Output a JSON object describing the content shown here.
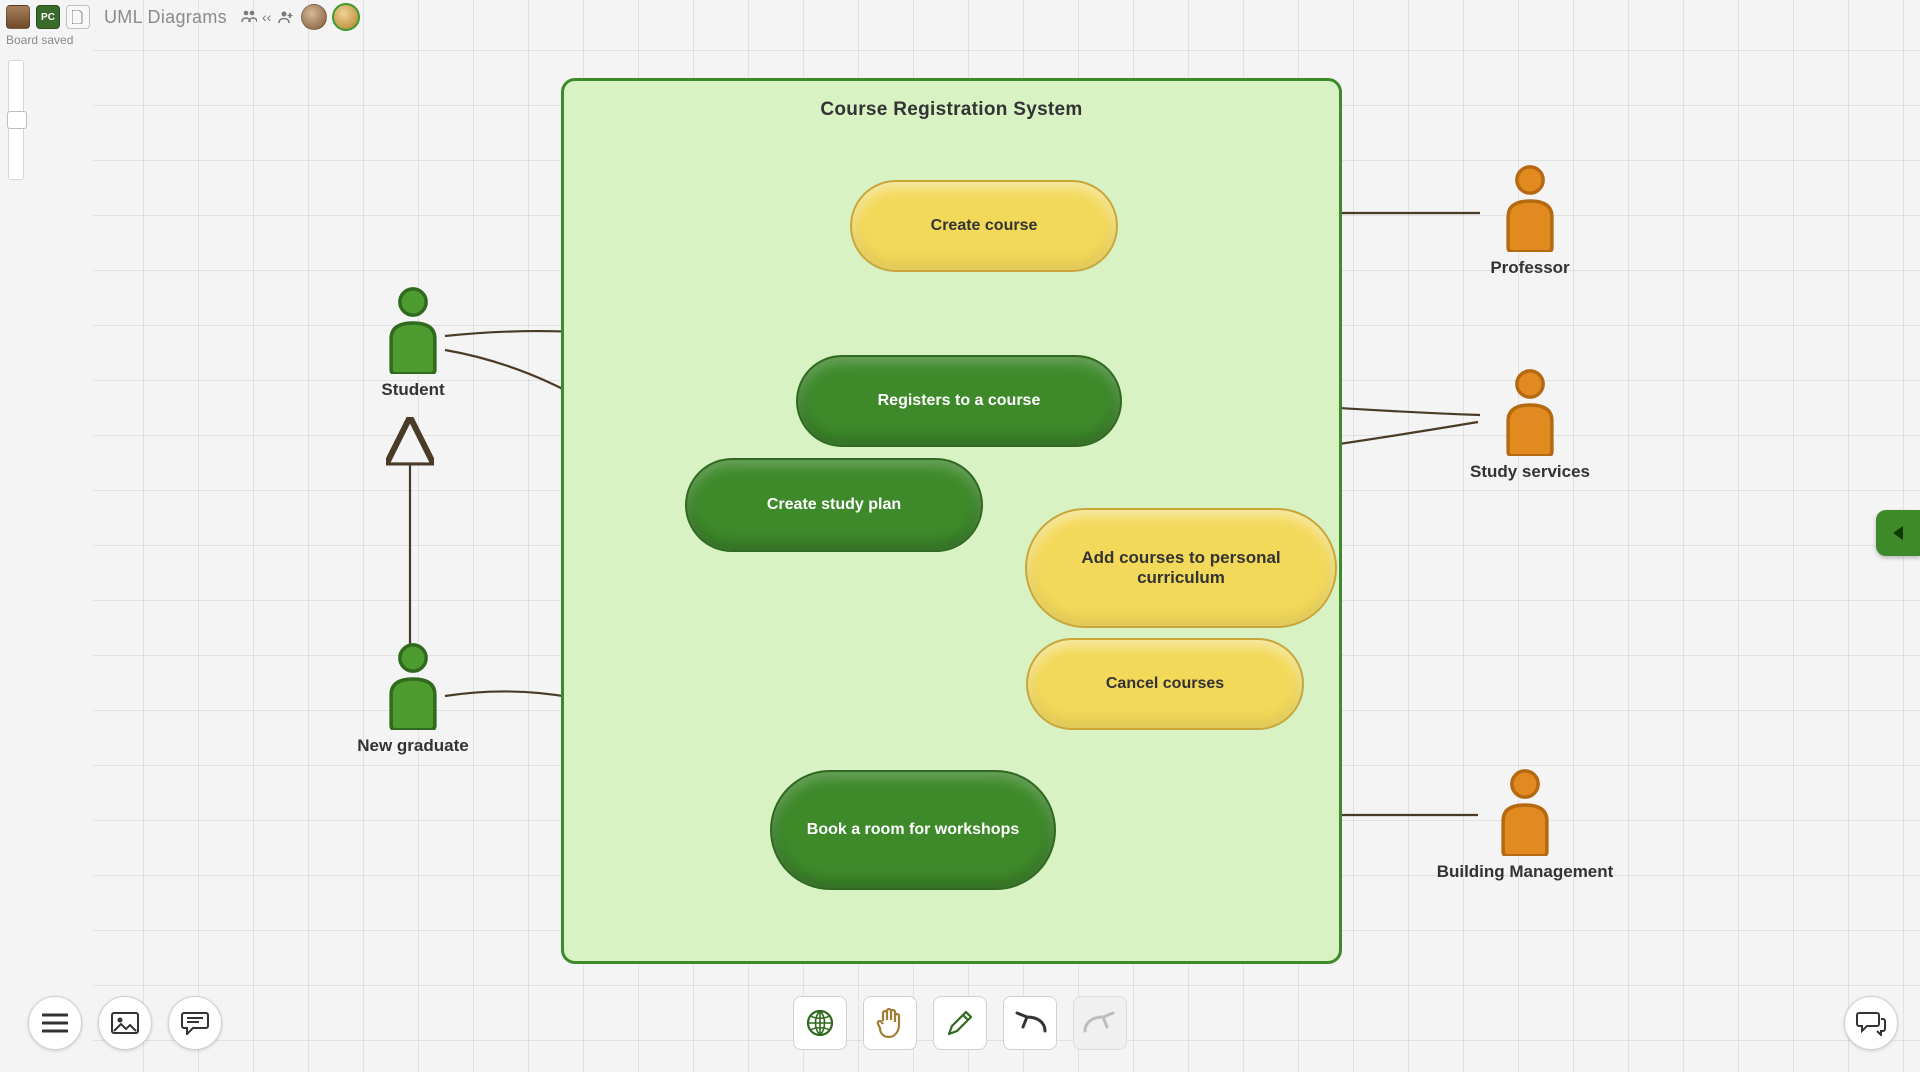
{
  "app": {
    "title": "UML Diagrams",
    "status": "Board saved",
    "pc_label": "PC"
  },
  "diagram": {
    "system_title": "Course Registration System",
    "actors": {
      "student": "Student",
      "new_graduate": "New graduate",
      "professor": "Professor",
      "study_services": "Study services",
      "building_management": "Building Management"
    },
    "usecases": {
      "create_course": "Create course",
      "registers_course": "Registers to a course",
      "create_study_plan": "Create study plan",
      "add_courses": "Add courses to personal curriculum",
      "cancel_courses": "Cancel courses",
      "book_room": "Book a room for workshops"
    }
  },
  "toolbar": {
    "menu": "menu",
    "image": "image",
    "comment": "comment",
    "globe": "globe",
    "hand": "hand",
    "pencil": "pencil",
    "undo": "undo",
    "redo": "redo",
    "chat": "chat"
  }
}
